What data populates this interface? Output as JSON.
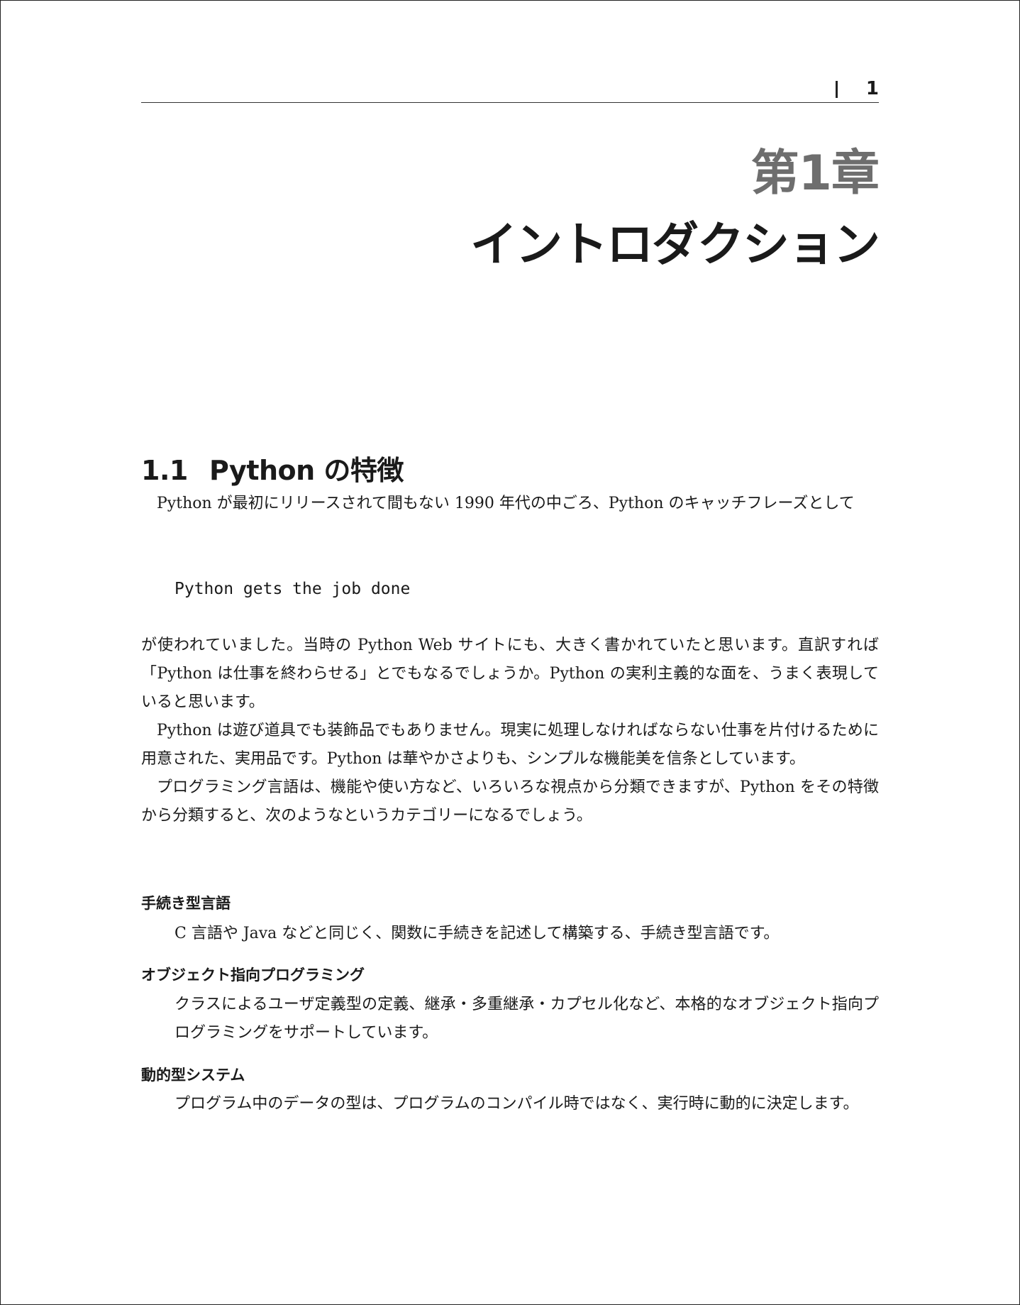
{
  "header": {
    "page_number": "1"
  },
  "chapter": {
    "label": "第1章",
    "title": "イントロダクション"
  },
  "section": {
    "number": "1.1",
    "title": "Python の特徴"
  },
  "intro": {
    "paragraph_1": "Python が最初にリリースされて間もない 1990 年代の中ごろ、Python のキャッチフレーズとして",
    "code": "Python gets the job done",
    "paragraph_2": "が使われていました。当時の Python Web サイトにも、大きく書かれていたと思います。直訳すれば「Python は仕事を終わらせる」とでもなるでしょうか。Python の実利主義的な面を、うまく表現していると思います。",
    "paragraph_3": "Python は遊び道具でも装飾品でもありません。現実に処理しなければならない仕事を片付けるために用意された、実用品です。Python は華やかさよりも、シンプルな機能美を信条としています。",
    "paragraph_4": "プログラミング言語は、機能や使い方など、いろいろな視点から分類できますが、Python をその特徴から分類すると、次のようなというカテゴリーになるでしょう。"
  },
  "features": [
    {
      "term": "手続き型言語",
      "description": "C 言語や Java などと同じく、関数に手続きを記述して構築する、手続き型言語です。"
    },
    {
      "term": "オブジェクト指向プログラミング",
      "description": "クラスによるユーザ定義型の定義、継承・多重継承・カプセル化など、本格的なオブジェクト指向プログラミングをサポートしています。"
    },
    {
      "term": "動的型システム",
      "description": "プログラム中のデータの型は、プログラムのコンパイル時ではなく、実行時に動的に決定します。"
    }
  ]
}
